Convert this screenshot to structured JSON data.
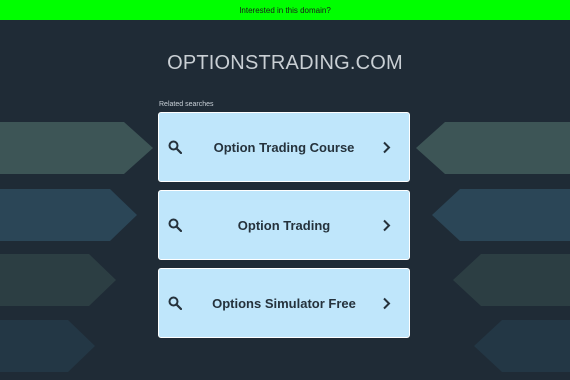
{
  "banner": {
    "text": "Interested in this domain?",
    "color": "#00ff00"
  },
  "domain": {
    "name": "OPTIONSTRADING.COM"
  },
  "related": {
    "label": "Related searches",
    "items": [
      {
        "label": "Option Trading Course",
        "icon": "search-icon",
        "chevron": "chevron-right-icon"
      },
      {
        "label": "Option Trading",
        "icon": "search-icon",
        "chevron": "chevron-right-icon"
      },
      {
        "label": "Options Simulator Free",
        "icon": "search-icon",
        "chevron": "chevron-right-icon"
      }
    ]
  },
  "colors": {
    "background": "#1f2b36",
    "card": "#bfe6fb",
    "card_border": "#ffffff",
    "arrow_teal": "#3e5657",
    "arrow_blue": "#2a4555"
  }
}
